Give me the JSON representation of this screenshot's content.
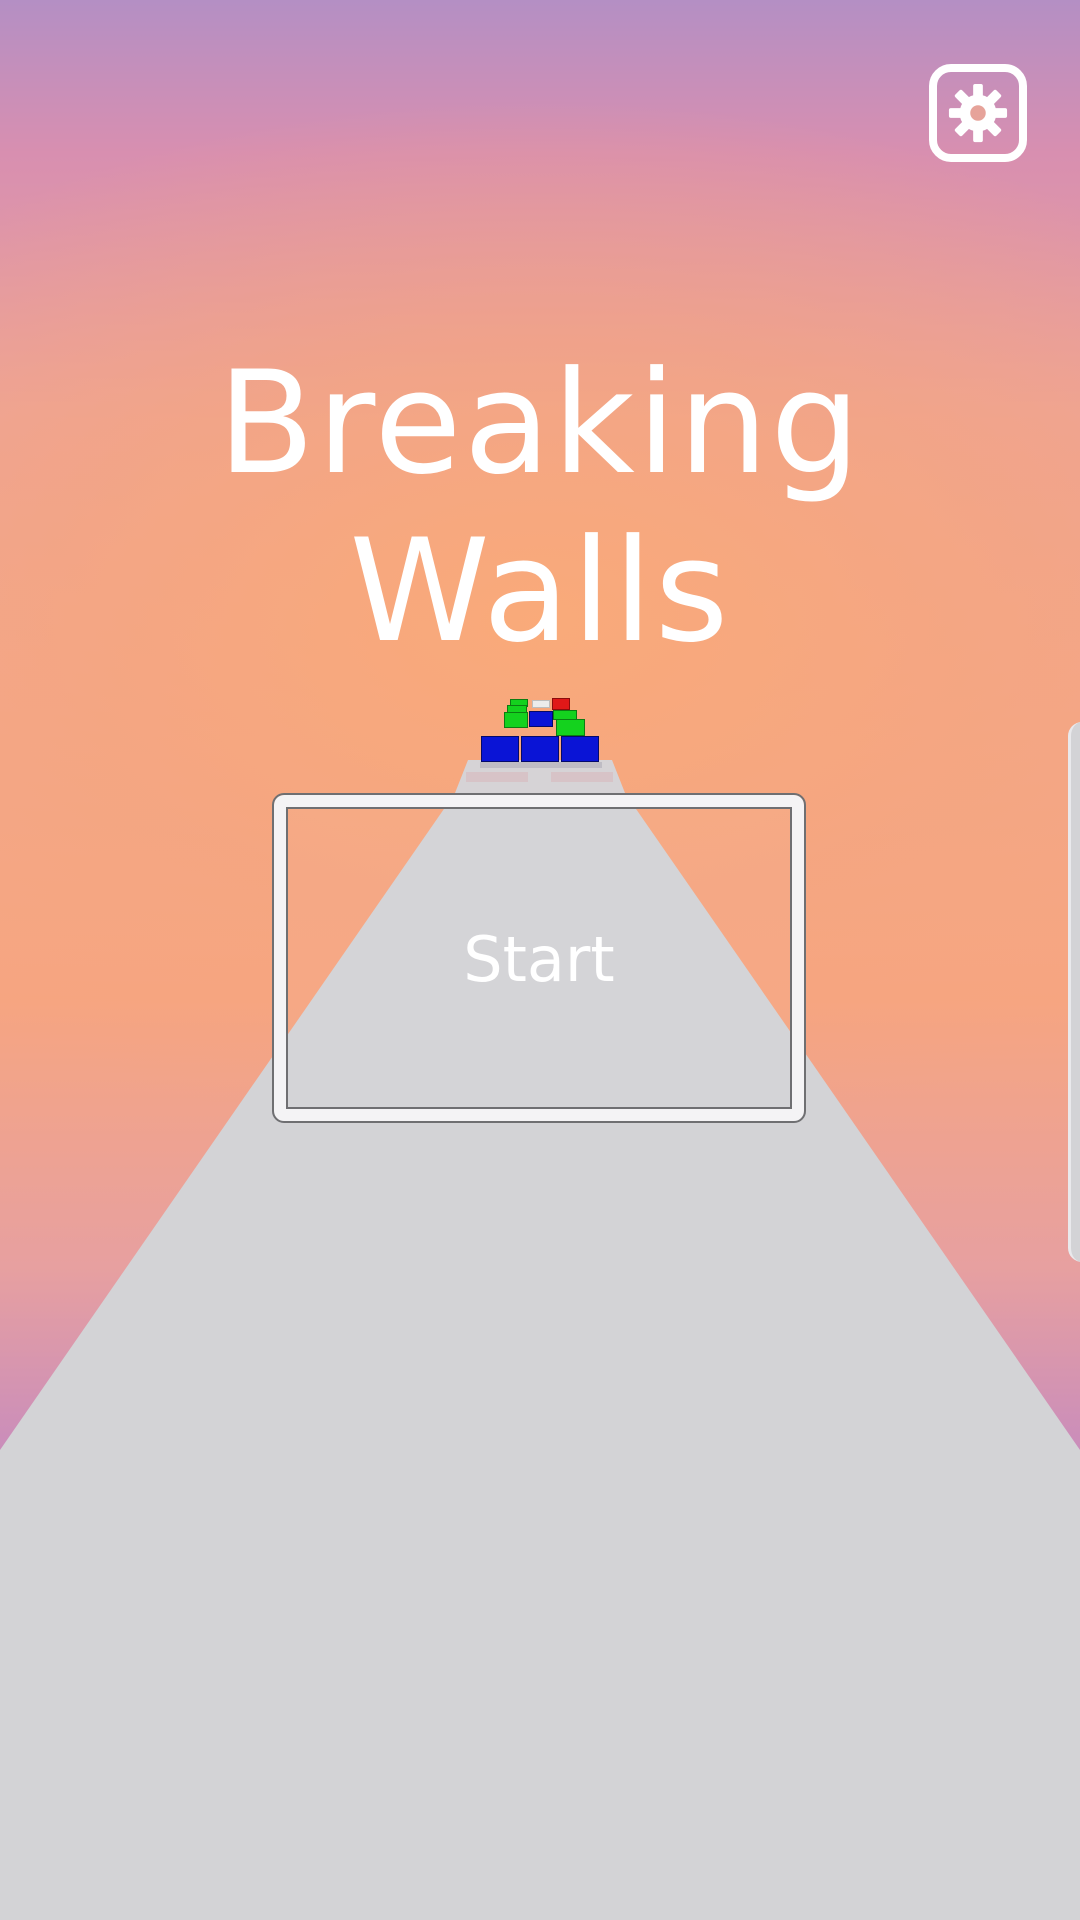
{
  "game": {
    "title_line1": "Breaking",
    "title_line2": "Walls",
    "start_label": "Start",
    "settings_icon": "gear-icon"
  },
  "colors": {
    "sky_top": "#b48fc4",
    "sky_mid": "#f6a581",
    "sky_bottom": "#a47ccc",
    "road": "#d3d3d6",
    "block_blue": "#0a14d6",
    "block_green": "#14d21e",
    "block_red": "#e01818",
    "text": "#ffffff"
  }
}
